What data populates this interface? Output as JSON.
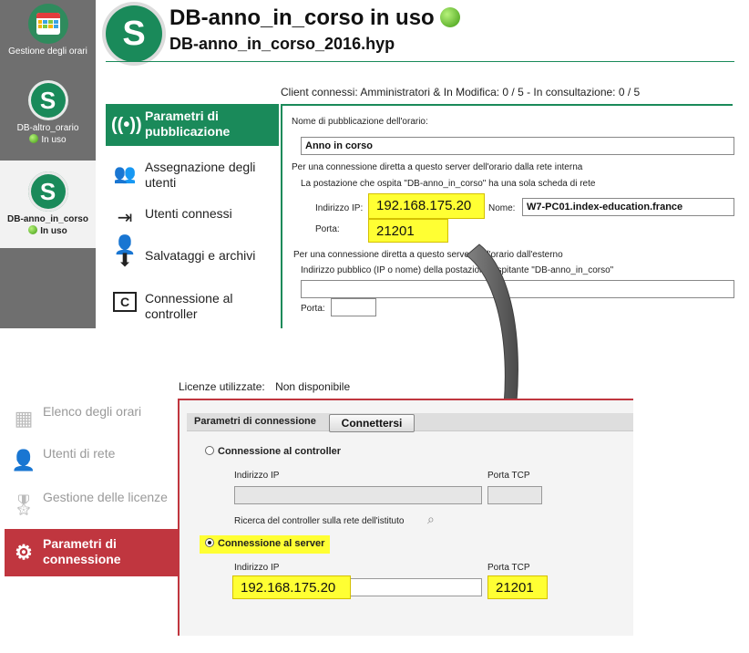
{
  "rail": {
    "items": [
      {
        "label": "Gestione degli orari",
        "status": ""
      },
      {
        "label": "DB-altro_orario",
        "status": "In uso"
      },
      {
        "label": "DB-anno_in_corso",
        "status": "In uso"
      }
    ],
    "logo_letter": "S"
  },
  "header": {
    "title": "DB-anno_in_corso in uso",
    "subtitle": "DB-anno_in_corso_2016.hyp",
    "clients": "Client connessi: Amministratori & In Modifica: 0 / 5 - In consultazione: 0 / 5"
  },
  "menu": {
    "items": [
      {
        "label": "Parametri di pubblicazione",
        "icon": "broadcast-icon"
      },
      {
        "label": "Assegnazione degli utenti",
        "icon": "users-icon"
      },
      {
        "label": "Utenti connessi",
        "icon": "user-connected-icon"
      },
      {
        "label": "Salvataggi e archivi",
        "icon": "archive-icon"
      },
      {
        "label": "Connessione al controller",
        "icon": "controller-icon"
      }
    ]
  },
  "publication": {
    "name_label": "Nome di pubblicazione dell'orario:",
    "name_value": "Anno in corso",
    "internal_heading": "Per una connessione diretta a questo server dell'orario dalla rete interna",
    "single_card_note": "La postazione che ospita \"DB-anno_in_corso\" ha una sola scheda di rete",
    "ip_label": "Indirizzo IP:",
    "ip_value": "192.168.175.20",
    "name_field_label": "Nome:",
    "name_field_value": "W7-PC01.index-education.france",
    "port_label": "Porta:",
    "port_value": "21201",
    "external_heading": "Per una connessione diretta a questo server dell'orario dall'esterno",
    "public_address_label": "Indirizzo pubblico (IP o nome) della postazione ospitante \"DB-anno_in_corso\"",
    "public_address_value": "",
    "external_port_label": "Porta:",
    "external_port_value": ""
  },
  "licence": {
    "label": "Licenze utilizzate:",
    "value": "Non disponibile"
  },
  "bottom_menu": {
    "items": [
      {
        "label": "Elenco degli orari",
        "icon": "calendar-grid-icon"
      },
      {
        "label": "Utenti di rete",
        "icon": "network-user-icon"
      },
      {
        "label": "Gestione delle licenze",
        "icon": "licence-icon"
      },
      {
        "label": "Parametri di connessione",
        "icon": "gear-icon"
      }
    ]
  },
  "connection": {
    "section_title": "Parametri di connessione",
    "connect_button": "Connettersi",
    "controller_option": "Connessione al controller",
    "controller_ip_label": "Indirizzo IP",
    "controller_port_label": "Porta TCP",
    "search_controller_label": "Ricerca del controller sulla rete dell'istituto",
    "server_option": "Connessione al server",
    "server_ip_label": "Indirizzo IP",
    "server_ip_value": "192.168.175.20",
    "server_port_label": "Porta TCP",
    "server_port_value": "21201"
  },
  "colors": {
    "green": "#1a8a5a",
    "red": "#c0363f",
    "highlight": "#ffff33"
  }
}
